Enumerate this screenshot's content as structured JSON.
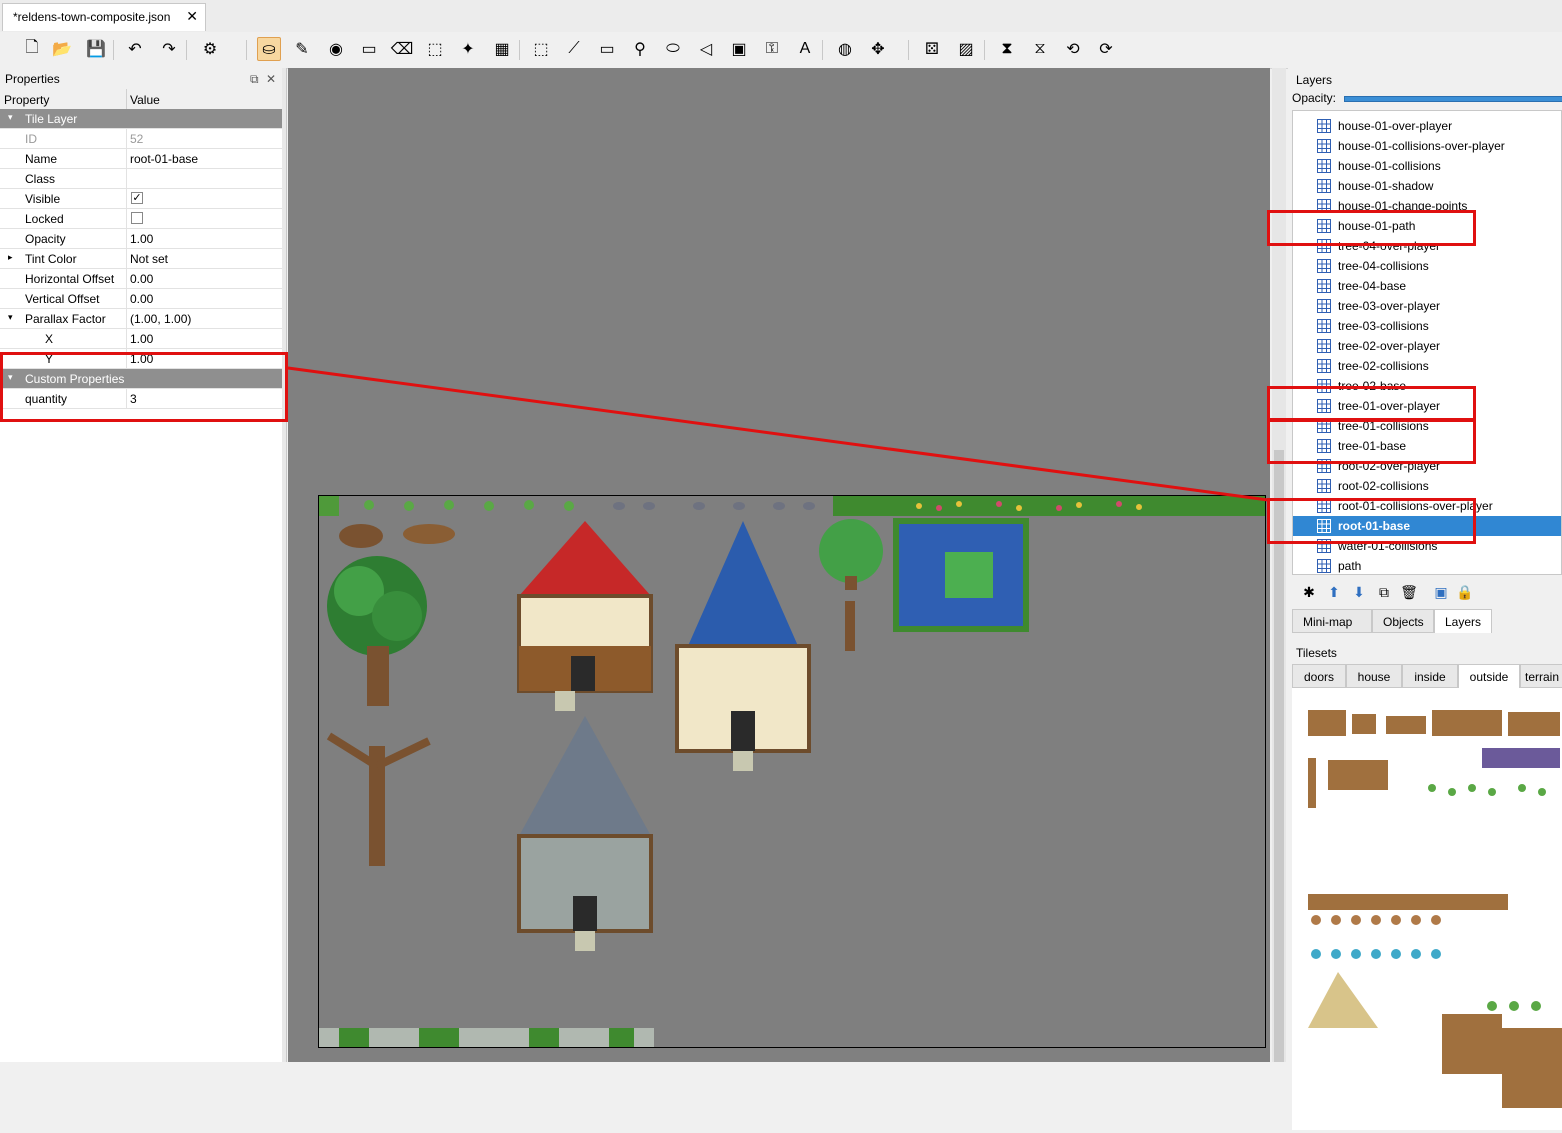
{
  "tab": {
    "title": "*reldens-town-composite.json",
    "close": "✕"
  },
  "toolbar": {
    "buttons": [
      {
        "name": "new-map-icon",
        "glyph": "🗋"
      },
      {
        "name": "open-icon",
        "glyph": "📂"
      },
      {
        "name": "save-icon",
        "glyph": "💾"
      },
      {
        "name": "undo-icon",
        "glyph": "↶"
      },
      {
        "name": "redo-icon",
        "glyph": "↷"
      },
      {
        "name": "commands-icon",
        "glyph": "⚙"
      },
      {
        "name": "stamp-brush-icon",
        "glyph": "⛀"
      },
      {
        "name": "terrain-brush-icon",
        "glyph": "✎"
      },
      {
        "name": "bucket-fill-icon",
        "glyph": "◉"
      },
      {
        "name": "shape-fill-icon",
        "glyph": "▭"
      },
      {
        "name": "eraser-icon",
        "glyph": "⌫"
      },
      {
        "name": "rect-select-icon",
        "glyph": "⬚"
      },
      {
        "name": "magic-wand-icon",
        "glyph": "✦"
      },
      {
        "name": "select-same-tile-icon",
        "glyph": "▦"
      },
      {
        "name": "select-objects-icon",
        "glyph": "⬚"
      },
      {
        "name": "edit-polygons-icon",
        "glyph": "⟋"
      },
      {
        "name": "insert-rectangle-icon",
        "glyph": "▭"
      },
      {
        "name": "insert-point-icon",
        "glyph": "⚲"
      },
      {
        "name": "insert-ellipse-icon",
        "glyph": "⬭"
      },
      {
        "name": "insert-polygon-icon",
        "glyph": "◁"
      },
      {
        "name": "insert-tile-icon",
        "glyph": "▣"
      },
      {
        "name": "insert-template-icon",
        "glyph": "⚿"
      },
      {
        "name": "insert-text-icon",
        "glyph": "A"
      },
      {
        "name": "world-tool-icon",
        "glyph": "◍"
      },
      {
        "name": "move-icon",
        "glyph": "✥"
      },
      {
        "name": "random-mode-icon",
        "glyph": "⚄"
      },
      {
        "name": "wang-fill-icon",
        "glyph": "▨"
      },
      {
        "name": "flip-horizontal-icon",
        "glyph": "⧗"
      },
      {
        "name": "flip-vertical-icon",
        "glyph": "⧖"
      },
      {
        "name": "rotate-left-icon",
        "glyph": "⟲"
      },
      {
        "name": "rotate-right-icon",
        "glyph": "⟳"
      }
    ]
  },
  "properties": {
    "title": "Properties",
    "col_property": "Property",
    "col_value": "Value",
    "rows": [
      {
        "key": "Tile Layer",
        "value": "",
        "type": "group",
        "caret": "▾"
      },
      {
        "key": "ID",
        "value": "52",
        "type": "disabled"
      },
      {
        "key": "Name",
        "value": "root-01-base",
        "type": "normal"
      },
      {
        "key": "Class",
        "value": "",
        "type": "normal"
      },
      {
        "key": "Visible",
        "value": "✓",
        "type": "checkbox"
      },
      {
        "key": "Locked",
        "value": "",
        "type": "checkbox"
      },
      {
        "key": "Opacity",
        "value": "1.00",
        "type": "normal"
      },
      {
        "key": "Tint Color",
        "value": "Not set",
        "type": "normal",
        "caret": "▸"
      },
      {
        "key": "Horizontal Offset",
        "value": "0.00",
        "type": "normal"
      },
      {
        "key": "Vertical Offset",
        "value": "0.00",
        "type": "normal"
      },
      {
        "key": "Parallax Factor",
        "value": "(1.00, 1.00)",
        "type": "normal",
        "caret": "▾"
      },
      {
        "key": "X",
        "value": "1.00",
        "type": "sub"
      },
      {
        "key": "Y",
        "value": "1.00",
        "type": "sub"
      },
      {
        "key": "Custom Properties",
        "value": "",
        "type": "group",
        "caret": "▾"
      },
      {
        "key": "quantity",
        "value": "3",
        "type": "custom"
      }
    ]
  },
  "layers": {
    "title": "Layers",
    "opacity_label": "Opacity:",
    "items": [
      "house-01-over-player",
      "house-01-collisions-over-player",
      "house-01-collisions",
      "house-01-shadow",
      "house-01-change-points",
      "house-01-path",
      "tree-04-over-player",
      "tree-04-collisions",
      "tree-04-base",
      "tree-03-over-player",
      "tree-03-collisions",
      "tree-02-over-player",
      "tree-02-collisions",
      "tree-02-base",
      "tree-01-over-player",
      "tree-01-collisions",
      "tree-01-base",
      "root-02-over-player",
      "root-02-collisions",
      "root-01-collisions-over-player",
      "root-01-base",
      "water-01-collisions",
      "path"
    ],
    "selected": "root-01-base"
  },
  "bottom_tabs": [
    "Mini-map",
    "Objects",
    "Layers"
  ],
  "tilesets": {
    "label": "Tilesets",
    "tabs": [
      "doors",
      "house",
      "inside",
      "outside",
      "terrain"
    ]
  },
  "colors": {
    "selection": "#3087d3",
    "annotation": "#e01010",
    "map_bg": "#7f7f7f",
    "group_row": "#8f8f8f"
  }
}
